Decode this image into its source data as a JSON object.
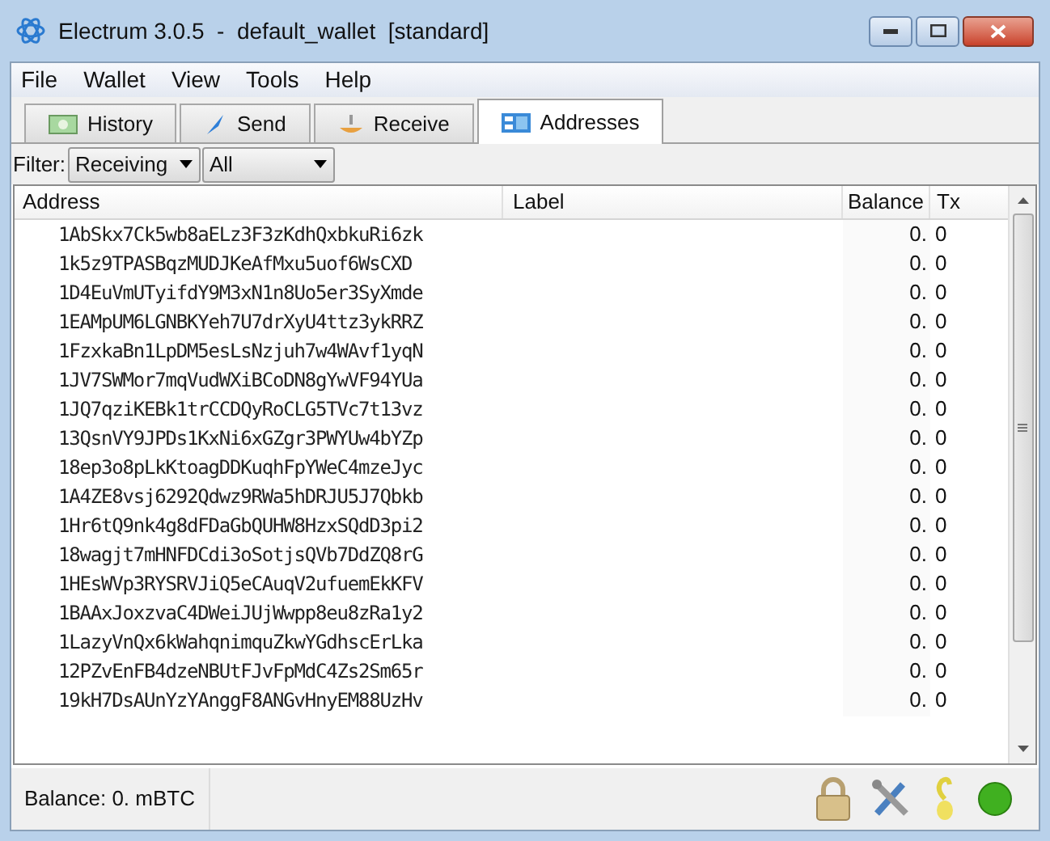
{
  "window": {
    "title": "Electrum 3.0.5  -  default_wallet  [standard]"
  },
  "menu": [
    "File",
    "Wallet",
    "View",
    "Tools",
    "Help"
  ],
  "tabs": [
    {
      "label": "History",
      "selected": false,
      "kind": "history"
    },
    {
      "label": "Send",
      "selected": false,
      "kind": "send"
    },
    {
      "label": "Receive",
      "selected": false,
      "kind": "receive"
    },
    {
      "label": "Addresses",
      "selected": true,
      "kind": "addresses"
    }
  ],
  "filter": {
    "label": "Filter:",
    "type": "Receiving",
    "status": "All"
  },
  "table": {
    "columns": [
      "Address",
      "Label",
      "Balance",
      "Tx"
    ],
    "rows": [
      {
        "address": "1AbSkx7Ck5wb8aELz3F3zKdhQxbkuRi6zk",
        "balance": "0.",
        "tx": "0"
      },
      {
        "address": "1k5z9TPASBqzMUDJKeAfMxu5uof6WsCXD",
        "balance": "0.",
        "tx": "0"
      },
      {
        "address": "1D4EuVmUTyifdY9M3xN1n8Uo5er3SyXmde",
        "balance": "0.",
        "tx": "0"
      },
      {
        "address": "1EAMpUM6LGNBKYeh7U7drXyU4ttz3ykRRZ",
        "balance": "0.",
        "tx": "0"
      },
      {
        "address": "1FzxkaBn1LpDM5esLsNzjuh7w4WAvf1yqN",
        "balance": "0.",
        "tx": "0"
      },
      {
        "address": "1JV7SWMor7mqVudWXiBCoDN8gYwVF94YUa",
        "balance": "0.",
        "tx": "0"
      },
      {
        "address": "1JQ7qziKEBk1trCCDQyRoCLG5TVc7t13vz",
        "balance": "0.",
        "tx": "0"
      },
      {
        "address": "13QsnVY9JPDs1KxNi6xGZgr3PWYUw4bYZp",
        "balance": "0.",
        "tx": "0"
      },
      {
        "address": "18ep3o8pLkKtoagDDKuqhFpYWeC4mzeJyc",
        "balance": "0.",
        "tx": "0"
      },
      {
        "address": "1A4ZE8vsj6292Qdwz9RWa5hDRJU5J7Qbkb",
        "balance": "0.",
        "tx": "0"
      },
      {
        "address": "1Hr6tQ9nk4g8dFDaGbQUHW8HzxSQdD3pi2",
        "balance": "0.",
        "tx": "0"
      },
      {
        "address": "18wagjt7mHNFDCdi3oSotjsQVb7DdZQ8rG",
        "balance": "0.",
        "tx": "0"
      },
      {
        "address": "1HEsWVp3RYSRVJiQ5eCAuqV2ufuemEkKFV",
        "balance": "0.",
        "tx": "0"
      },
      {
        "address": "1BAAxJoxzvaC4DWeiJUjWwpp8eu8zRa1y2",
        "balance": "0.",
        "tx": "0"
      },
      {
        "address": "1LazyVnQx6kWahqnimquZkwYGdhscErLka",
        "balance": "0.",
        "tx": "0"
      },
      {
        "address": "12PZvEnFB4dzeNBUtFJvFpMdC4Zs2Sm65r",
        "balance": "0.",
        "tx": "0"
      },
      {
        "address": "19kH7DsAUnYzYAnggF8ANGvHnyEM88UzHv",
        "balance": "0.",
        "tx": "0"
      }
    ]
  },
  "status_bar": {
    "balance": "Balance: 0. mBTC",
    "connected": true
  }
}
